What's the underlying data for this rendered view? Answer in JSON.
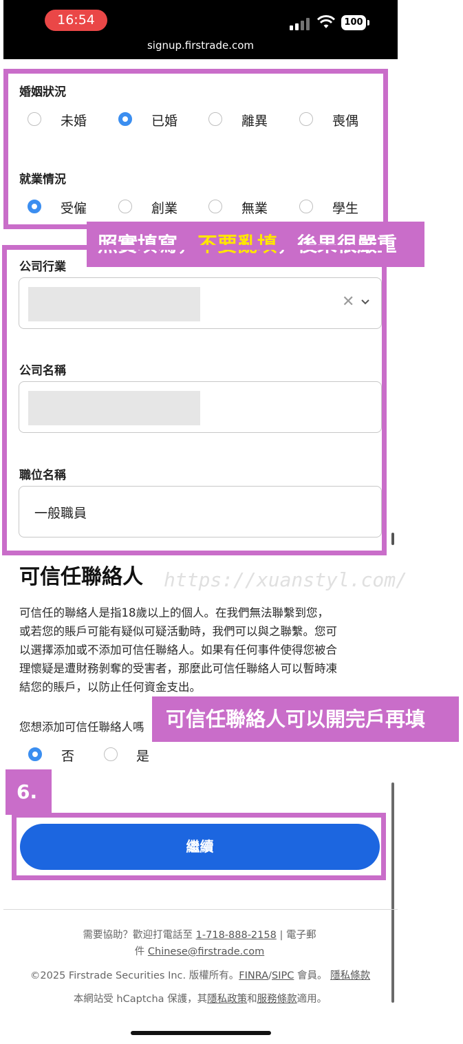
{
  "status": {
    "time": "16:54",
    "url": "signup.firstrade.com",
    "battery": "100"
  },
  "marital": {
    "label": "婚姻狀況",
    "options": [
      "未婚",
      "已婚",
      "離異",
      "喪偶"
    ],
    "selected": "已婚"
  },
  "employment": {
    "label": "就業情況",
    "options": [
      "受僱",
      "創業",
      "無業",
      "學生"
    ],
    "selected": "受僱"
  },
  "annotation1": {
    "part1": "照實填寫，",
    "part2": "不要亂填",
    "part3": "，後果很嚴重"
  },
  "company": {
    "industry_label": "公司行業",
    "name_label": "公司名稱",
    "title_label": "職位名稱",
    "title_value": "一般職員"
  },
  "trusted": {
    "heading": "可信任聯絡人",
    "paragraph_lines": [
      "可信任的聯絡人是指18歲以上的個人。在我們無法聯繫到您，",
      "或若您的賬戶可能有疑似可疑活動時，我們可以與之聯繫。您可",
      "以選擇添加或不添加可信任聯絡人。如果有任何事件使得您被合",
      "理懷疑是遭財務剝奪的受害者，那麼此可信任聯絡人可以暫時凍",
      "結您的賬戶，以防止任何資金支出。"
    ],
    "question": "您想添加可信任聯絡人嗎",
    "options": [
      "否",
      "是"
    ],
    "selected": "否"
  },
  "annotation2": "可信任聯絡人可以開完戶再填",
  "step_label": "6.",
  "continue_button": "繼續",
  "watermark": "https://xuanstyl.com/",
  "footer": {
    "help_prefix": "需要協助？歡迎打電話至",
    "phone": "1-718-888-2158",
    "separator": "|",
    "email_prefix1": "電子郵",
    "email_prefix2": "件",
    "email": "Chinese@firstrade.com",
    "copyright": "©2025 Firstrade Securities Inc. 版權所有。",
    "finra": "FINRA",
    "slash": "/",
    "sipc": "SIPC",
    "member": "會員。",
    "privacy": "隱私條款",
    "captcha_prefix": "本網站受 hCaptcha 保護，其",
    "privacy_policy": "隱私政策",
    "and": "和",
    "terms": "服務條款",
    "applies": "適用。"
  },
  "colors": {
    "accent": "#1c66e0",
    "radio": "#3b8ef0",
    "annotation": "#c96dc9",
    "highlight": "#ffe600"
  }
}
